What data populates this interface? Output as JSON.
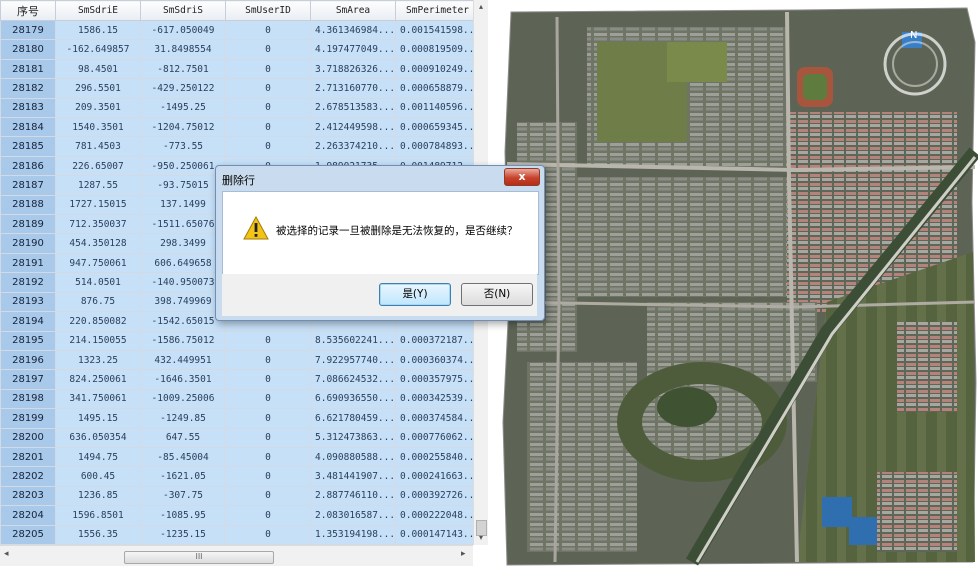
{
  "grid": {
    "columns": [
      "序号",
      "SmSdriE",
      "SmSdriS",
      "SmUserID",
      "SmArea",
      "SmPerimeter"
    ],
    "rows": [
      [
        "28179",
        "1586.15",
        "-617.050049",
        "0",
        "4.361346984...",
        "0.001541598..."
      ],
      [
        "28180",
        "-162.649857",
        "31.8498554",
        "0",
        "4.197477049...",
        "0.000819509..."
      ],
      [
        "28181",
        "98.4501",
        "-812.7501",
        "0",
        "3.718826326...",
        "0.000910249..."
      ],
      [
        "28182",
        "296.5501",
        "-429.250122",
        "0",
        "2.713160770...",
        "0.000658879..."
      ],
      [
        "28183",
        "209.3501",
        "-1495.25",
        "0",
        "2.678513583...",
        "0.001140596..."
      ],
      [
        "28184",
        "1540.3501",
        "-1204.75012",
        "0",
        "2.412449598...",
        "0.000659345..."
      ],
      [
        "28185",
        "781.4503",
        "-773.55",
        "0",
        "2.263374210...",
        "0.000784893..."
      ],
      [
        "28186",
        "226.65007",
        "-950.250061",
        "0",
        "1.989021735...",
        "0.001489712..."
      ],
      [
        "28187",
        "1287.55",
        "-93.75015",
        "",
        "",
        ""
      ],
      [
        "28188",
        "1727.15015",
        "137.1499",
        "",
        "",
        ""
      ],
      [
        "28189",
        "712.350037",
        "-1511.65076",
        "",
        "",
        ""
      ],
      [
        "28190",
        "454.350128",
        "298.3499",
        "",
        "",
        ""
      ],
      [
        "28191",
        "947.750061",
        "606.649658",
        "",
        "",
        ""
      ],
      [
        "28192",
        "514.0501",
        "-140.950073",
        "",
        "",
        ""
      ],
      [
        "28193",
        "876.75",
        "398.749969",
        "",
        "",
        ""
      ],
      [
        "28194",
        "220.850082",
        "-1542.65015",
        "",
        "",
        ""
      ],
      [
        "28195",
        "214.150055",
        "-1586.75012",
        "0",
        "8.535602241...",
        "0.000372187..."
      ],
      [
        "28196",
        "1323.25",
        "432.449951",
        "0",
        "7.922957740...",
        "0.000360374..."
      ],
      [
        "28197",
        "824.250061",
        "-1646.3501",
        "0",
        "7.086624532...",
        "0.000357975..."
      ],
      [
        "28198",
        "341.750061",
        "-1009.25006",
        "0",
        "6.690936550...",
        "0.000342539..."
      ],
      [
        "28199",
        "1495.15",
        "-1249.85",
        "0",
        "6.621780459...",
        "0.000374584..."
      ],
      [
        "28200",
        "636.050354",
        "647.55",
        "0",
        "5.312473863...",
        "0.000776062..."
      ],
      [
        "28201",
        "1494.75",
        "-85.45004",
        "0",
        "4.090880588...",
        "0.000255840..."
      ],
      [
        "28202",
        "600.45",
        "-1621.05",
        "0",
        "3.481441907...",
        "0.000241663..."
      ],
      [
        "28203",
        "1236.85",
        "-307.75",
        "0",
        "2.887746110...",
        "0.000392726..."
      ],
      [
        "28204",
        "1596.8501",
        "-1085.95",
        "0",
        "2.083016587...",
        "0.000222048..."
      ],
      [
        "28205",
        "1556.35",
        "-1235.15",
        "0",
        "1.353194198...",
        "0.000147143..."
      ]
    ],
    "h_scroll_thumb_glyph": "III",
    "left_arrow": "◂",
    "right_arrow": "▸",
    "up_arrow": "▴",
    "down_arrow": "▾"
  },
  "dialog": {
    "title": "删除行",
    "close_glyph": "x",
    "message": "被选择的记录一旦被删除是无法恢复的，是否继续？",
    "yes_label": "是(Y)",
    "no_label": "否(N)",
    "icon": "warning-icon"
  },
  "map": {
    "compass_label": "N",
    "icons": [
      "compass-icon"
    ]
  },
  "colors": {
    "grid_cell": "#c6e0f8",
    "grid_rownum": "#a9c9ea",
    "dialog_frame": "#c9dbee",
    "close_button": "#c7432c",
    "warning": "#f2c318"
  }
}
